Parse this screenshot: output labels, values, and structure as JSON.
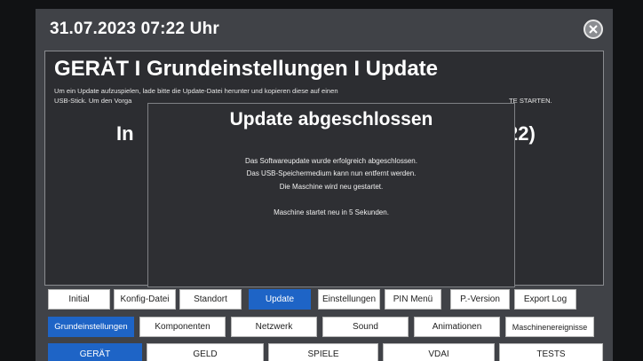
{
  "header": {
    "datetime": "31.07.2023 07:22 Uhr"
  },
  "page": {
    "title": "GERÄT I Grundeinstellungen I Update",
    "description_line1": "Um ein Update aufzuspielen, lade bitte die Update-Datei herunter und kopieren diese auf einen",
    "description_line2_start": "USB-Stick. Um den Vorga",
    "description_line2_end": "TE STARTEN.",
    "install_left": "In",
    "install_right": "22)"
  },
  "modal": {
    "title": "Update abgeschlossen",
    "line1": "Das Softwareupdate wurde erfolgreich abgeschlossen.",
    "line2": "Das USB-Speichermedium kann nun entfernt werden.",
    "line3": "Die Maschine wird neu gestartet.",
    "line4": "Maschine startet neu in 5 Sekunden."
  },
  "tabs_row1": [
    {
      "label": "Initial",
      "active": false
    },
    {
      "label": "Konfig-Datei",
      "active": false
    },
    {
      "label": "Standort",
      "active": false
    },
    {
      "label": "Update",
      "active": true
    },
    {
      "label": "Einstellungen",
      "active": false
    },
    {
      "label": "PIN Menü",
      "active": false
    },
    {
      "label": "P.-Version",
      "active": false
    },
    {
      "label": "Export Log",
      "active": false
    }
  ],
  "tabs_row2": [
    {
      "label": "Grundeinstellungen",
      "active": true
    },
    {
      "label": "Komponenten",
      "active": false
    },
    {
      "label": "Netzwerk",
      "active": false
    },
    {
      "label": "Sound",
      "active": false
    },
    {
      "label": "Animationen",
      "active": false
    },
    {
      "label": "Maschinenereignisse",
      "active": false
    }
  ],
  "tabs_row3": [
    {
      "label": "GERÄT",
      "active": true
    },
    {
      "label": "GELD",
      "active": false
    },
    {
      "label": "SPIELE",
      "active": false
    },
    {
      "label": "VDAI",
      "active": false
    },
    {
      "label": "TESTS",
      "active": false
    }
  ],
  "colors": {
    "active_tab": "#1e64c6",
    "background": "#404247",
    "panel": "#2c2d31"
  },
  "icons": {
    "close": "close-icon"
  }
}
